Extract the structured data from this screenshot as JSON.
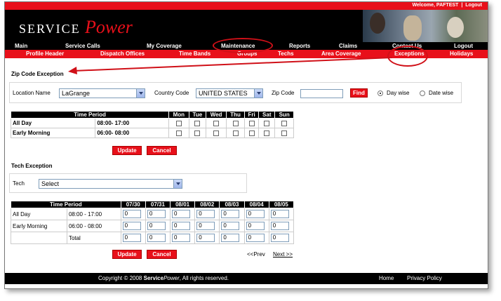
{
  "header": {
    "welcome_text": "Welcome, PAFTEST",
    "separator": "|",
    "logout_link": "Logout",
    "logo_part1": "SERVICE",
    "logo_part2": "Power"
  },
  "nav_primary": [
    {
      "label": "Main"
    },
    {
      "label": "Service Calls"
    },
    {
      "label": "My Coverage"
    },
    {
      "label": "Maintenance"
    },
    {
      "label": "Reports"
    },
    {
      "label": "Claims"
    },
    {
      "label": "Contact Us"
    },
    {
      "label": "Logout"
    }
  ],
  "nav_secondary": [
    {
      "label": "Profile Header"
    },
    {
      "label": "Dispatch Offices"
    },
    {
      "label": "Time Bands"
    },
    {
      "label": "Groups"
    },
    {
      "label": "Techs"
    },
    {
      "label": "Area Coverage"
    },
    {
      "label": "Exceptions"
    },
    {
      "label": "Holidays"
    }
  ],
  "zip_exception": {
    "title": "Zip Code Exception",
    "location_label": "Location Name",
    "location_value": "LaGrange",
    "country_label": "Country Code",
    "country_value": "UNITED STATES",
    "zip_label": "Zip Code",
    "zip_value": "",
    "find_button": "Find",
    "radio_daywise": "Day wise",
    "radio_datewise": "Date wise"
  },
  "day_table": {
    "header_period": "Time Period",
    "days": [
      "Mon",
      "Tue",
      "Wed",
      "Thu",
      "Fri",
      "Sat",
      "Sun"
    ],
    "rows": [
      {
        "name": "All Day",
        "time": "08:00- 17:00"
      },
      {
        "name": "Early Morning",
        "time": "06:00- 08:00"
      }
    ],
    "update_button": "Update",
    "cancel_button": "Cancel"
  },
  "tech_exception": {
    "title": "Tech Exception",
    "tech_label": "Tech",
    "tech_value": "Select"
  },
  "date_table": {
    "header_period": "Time Period",
    "dates": [
      "07/30",
      "07/31",
      "08/01",
      "08/02",
      "08/03",
      "08/04",
      "08/05"
    ],
    "rows": [
      {
        "name": "All Day",
        "time": "08:00 - 17:00",
        "values": [
          "0",
          "0",
          "0",
          "0",
          "0",
          "0",
          "0"
        ]
      },
      {
        "name": "Early Morning",
        "time": "06:00 - 08:00",
        "values": [
          "0",
          "0",
          "0",
          "0",
          "0",
          "0",
          "0"
        ]
      },
      {
        "name": "",
        "time": "Total",
        "values": [
          "0",
          "0",
          "0",
          "0",
          "0",
          "0",
          "0"
        ]
      }
    ],
    "update_button": "Update",
    "cancel_button": "Cancel",
    "prev_link": "<<Prev",
    "next_link": "Next >>"
  },
  "footer": {
    "copyright_prefix": "Copyright © 2008",
    "brand_service": "Service",
    "brand_power": "Power",
    "copyright_suffix": ", All rights reserved.",
    "home_link": "Home",
    "privacy_link": "Privacy Policy"
  },
  "colors": {
    "brand_red": "#e8101a",
    "nav_black": "#000000",
    "annotation_red": "#d01018"
  }
}
